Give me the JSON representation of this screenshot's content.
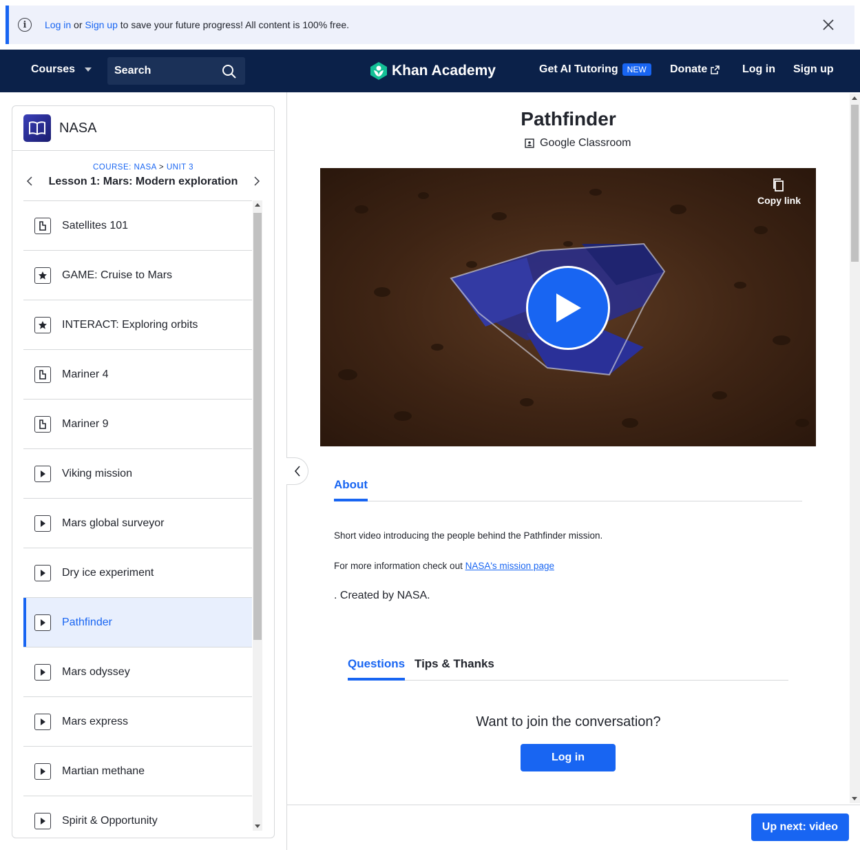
{
  "banner": {
    "login_link": "Log in",
    "or_text": " or ",
    "signup_link": "Sign up",
    "message_rest": " to save your future progress! All content is 100% free."
  },
  "nav": {
    "courses": "Courses",
    "search_placeholder": "Search",
    "logo_text": "Khan Academy",
    "ai_tutoring": "Get AI Tutoring",
    "new_badge": "NEW",
    "donate": "Donate",
    "login": "Log in",
    "signup": "Sign up"
  },
  "sidebar": {
    "course_title": "NASA",
    "breadcrumb_course": "COURSE: NASA",
    "breadcrumb_sep": " > ",
    "breadcrumb_unit": "UNIT 3",
    "lesson_title": "Lesson 1: Mars: Modern exploration",
    "items": [
      {
        "label": "Satellites 101",
        "icon": "article-icon"
      },
      {
        "label": "GAME: Cruise to Mars",
        "icon": "star-icon"
      },
      {
        "label": "INTERACT: Exploring orbits",
        "icon": "star-icon"
      },
      {
        "label": "Mariner 4",
        "icon": "article-icon"
      },
      {
        "label": "Mariner 9",
        "icon": "article-icon"
      },
      {
        "label": "Viking mission",
        "icon": "video-icon"
      },
      {
        "label": "Mars global surveyor",
        "icon": "video-icon"
      },
      {
        "label": "Dry ice experiment",
        "icon": "video-icon"
      },
      {
        "label": "Pathfinder",
        "icon": "video-icon",
        "active": true
      },
      {
        "label": "Mars odyssey",
        "icon": "video-icon"
      },
      {
        "label": "Mars express",
        "icon": "video-icon"
      },
      {
        "label": "Martian methane",
        "icon": "video-icon"
      },
      {
        "label": "Spirit & Opportunity",
        "icon": "video-icon"
      }
    ]
  },
  "main": {
    "title": "Pathfinder",
    "google_classroom": "Google Classroom",
    "copy_link": "Copy link",
    "tab_about": "About",
    "about_text": "Short video introducing the people behind the Pathfinder mission.",
    "more_info_prefix": "For more information check out ",
    "more_info_link": "NASA's mission page",
    "created_by": ". Created by NASA.",
    "tab_questions": "Questions",
    "tab_tips": "Tips & Thanks",
    "join_heading": "Want to join the conversation?",
    "join_login": "Log in",
    "up_next": "Up next: video"
  },
  "colors": {
    "accent": "#1865f2",
    "nav_bg": "#0b2149",
    "banner_bg": "#eef1fb",
    "active_item_bg": "#e8effd"
  }
}
